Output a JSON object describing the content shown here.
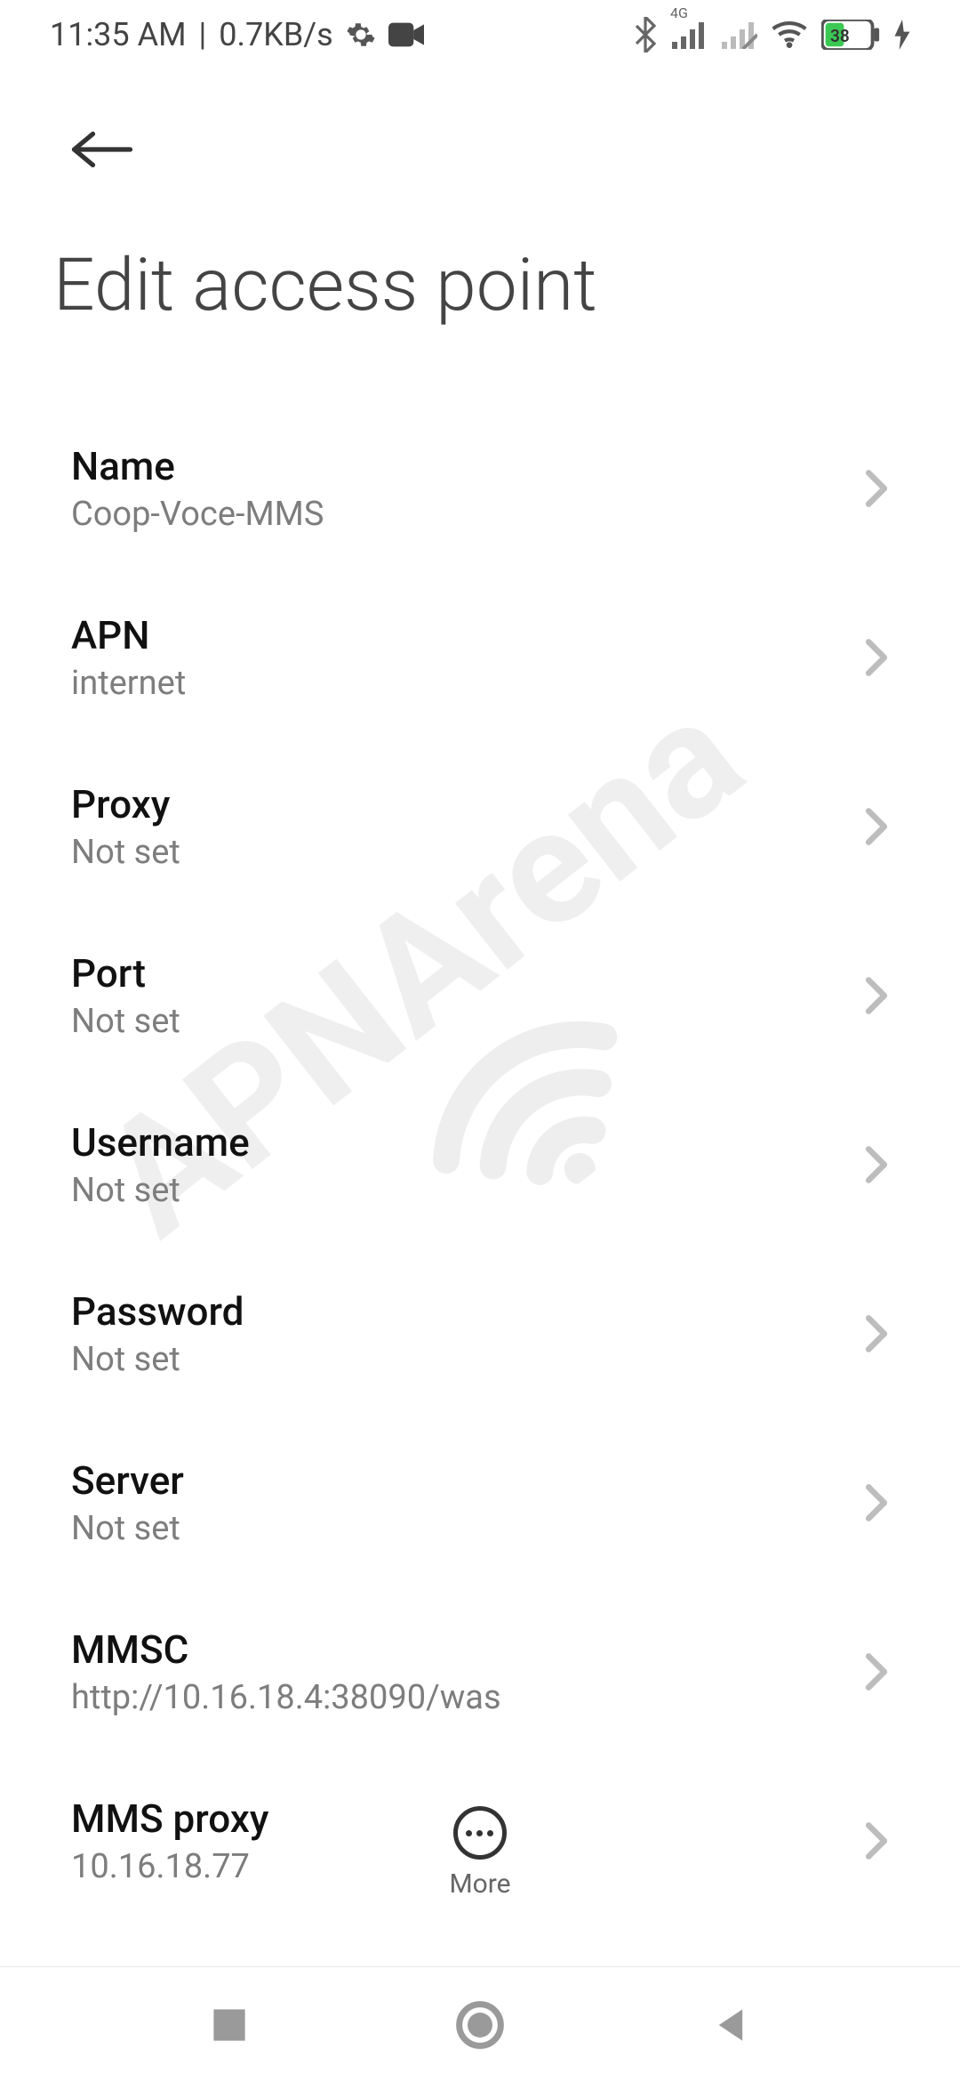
{
  "status": {
    "time": "11:35 AM",
    "sep": "|",
    "speed": "0.7KB/s",
    "network_gen": "4G",
    "battery_pct": "38"
  },
  "header": {
    "title": "Edit access point"
  },
  "settings": [
    {
      "label": "Name",
      "value": "Coop-Voce-MMS"
    },
    {
      "label": "APN",
      "value": "internet"
    },
    {
      "label": "Proxy",
      "value": "Not set"
    },
    {
      "label": "Port",
      "value": "Not set"
    },
    {
      "label": "Username",
      "value": "Not set"
    },
    {
      "label": "Password",
      "value": "Not set"
    },
    {
      "label": "Server",
      "value": "Not set"
    },
    {
      "label": "MMSC",
      "value": "http://10.16.18.4:38090/was"
    },
    {
      "label": "MMS proxy",
      "value": "10.16.18.77"
    }
  ],
  "more_label": "More",
  "watermark_text": "APNArena"
}
